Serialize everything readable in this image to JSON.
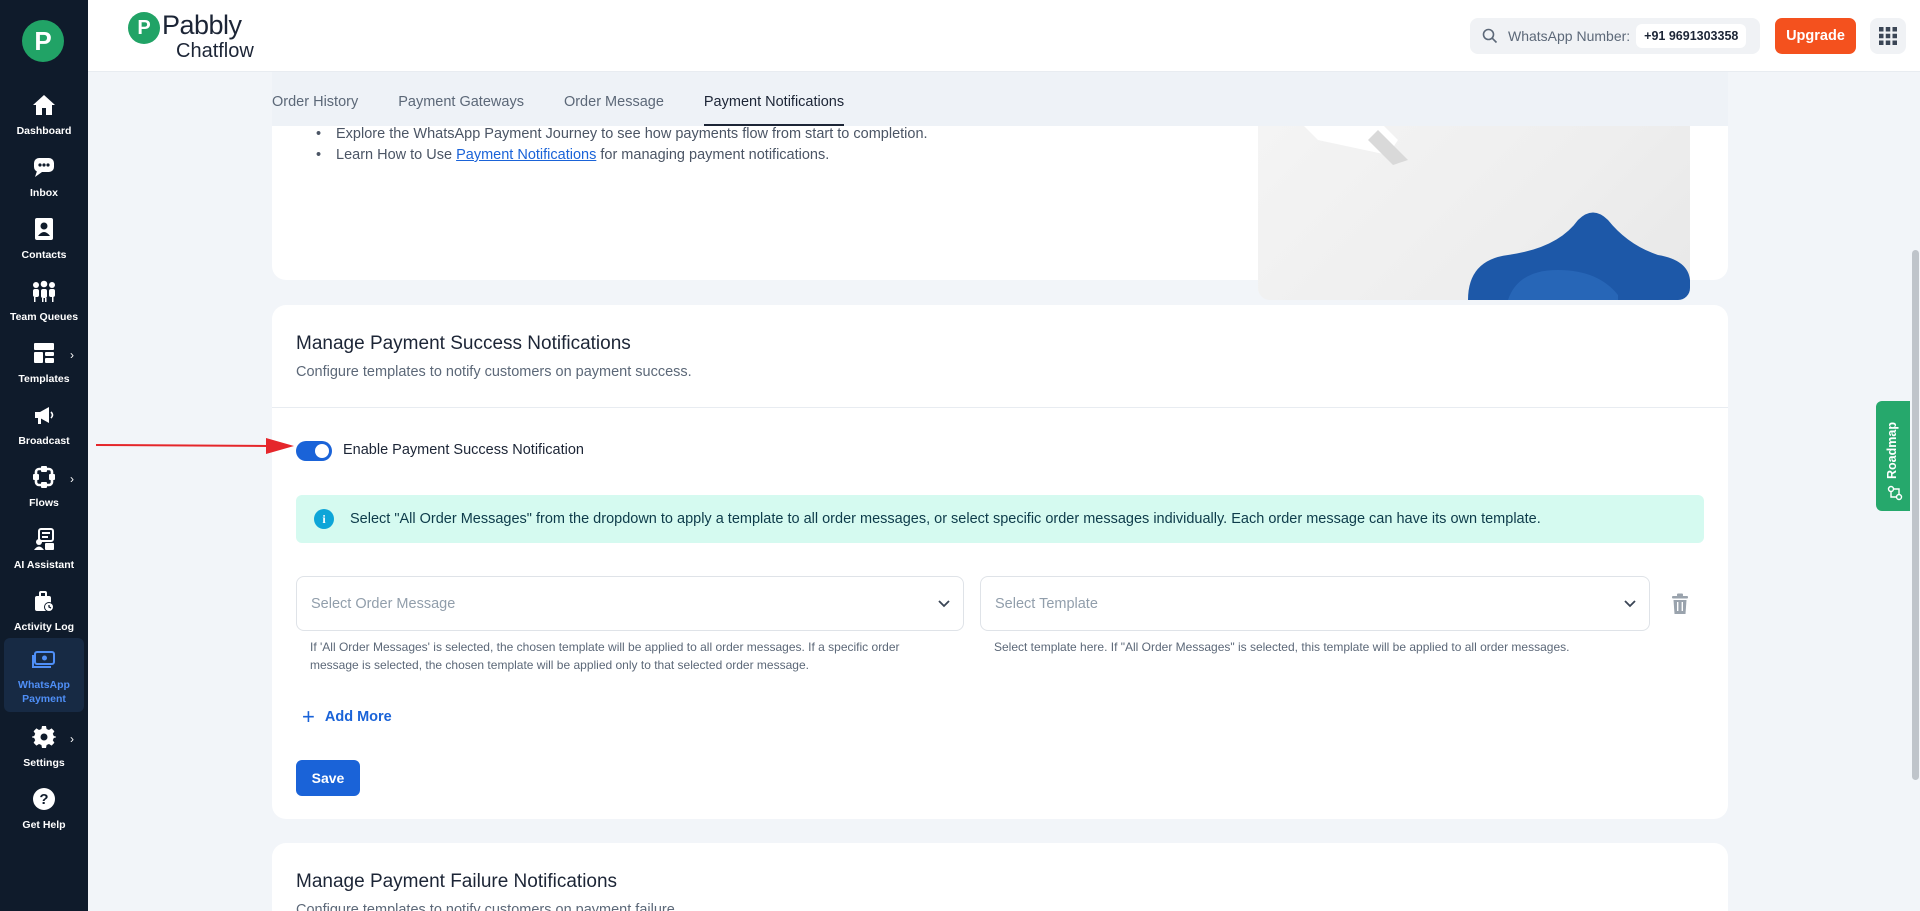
{
  "sidebar": {
    "logo": "P",
    "items": [
      {
        "label": "Dashboard",
        "icon": "home-icon"
      },
      {
        "label": "Inbox",
        "icon": "chat-icon"
      },
      {
        "label": "Contacts",
        "icon": "contact-book-icon"
      },
      {
        "label": "Team Queues",
        "icon": "team-icon"
      },
      {
        "label": "Templates",
        "icon": "templates-icon"
      },
      {
        "label": "Broadcast",
        "icon": "megaphone-icon"
      },
      {
        "label": "Flows",
        "icon": "flows-icon"
      },
      {
        "label": "AI Assistant",
        "icon": "ai-assistant-icon"
      },
      {
        "label": "Activity Log",
        "icon": "activity-log-icon"
      },
      {
        "label": "WhatsApp Payment",
        "icon": "payment-icon"
      },
      {
        "label": "Settings",
        "icon": "gear-icon"
      },
      {
        "label": "Get Help",
        "icon": "help-icon"
      }
    ]
  },
  "header": {
    "brand_top": "Pabbly",
    "brand_bottom": "Chatflow",
    "whatsapp_label": "WhatsApp Number:",
    "whatsapp_number": "+91 9691303358",
    "upgrade_label": "Upgrade"
  },
  "tabs": [
    {
      "label": "Order History"
    },
    {
      "label": "Payment Gateways"
    },
    {
      "label": "Order Message"
    },
    {
      "label": "Payment Notifications",
      "active": true
    }
  ],
  "intro": {
    "bullet1": "Explore the WhatsApp Payment Journey to see how payments flow from start to completion.",
    "bullet2_prefix": "Learn How to Use ",
    "bullet2_link": "Payment Notifications",
    "bullet2_suffix": " for managing payment notifications."
  },
  "success": {
    "title": "Manage Payment Success Notifications",
    "subtitle": "Configure templates to notify customers on payment success.",
    "toggle_label": "Enable Payment Success Notification",
    "toggle_on": true,
    "info_text": "Select \"All Order Messages\" from the dropdown to apply a template to all order messages, or select specific order messages individually. Each order message can have its own template.",
    "order_placeholder": "Select Order Message",
    "template_placeholder": "Select Template",
    "order_help": "If 'All Order Messages' is selected, the chosen template will be applied to all order messages. If a specific order message is selected, the chosen template will be applied only to that selected order message.",
    "template_help": "Select template here. If \"All Order Messages\" is selected, this template will be applied to all order messages.",
    "add_more": "Add More",
    "save": "Save"
  },
  "failure": {
    "title": "Manage Payment Failure Notifications",
    "subtitle": "Configure templates to notify customers on payment failure."
  },
  "roadmap": "Roadmap",
  "colors": {
    "accent": "#1a63d8",
    "sidebar": "#0f1b2b",
    "upgrade": "#f4511e",
    "info_bg": "#d5faf0",
    "brand_green": "#21a366"
  }
}
